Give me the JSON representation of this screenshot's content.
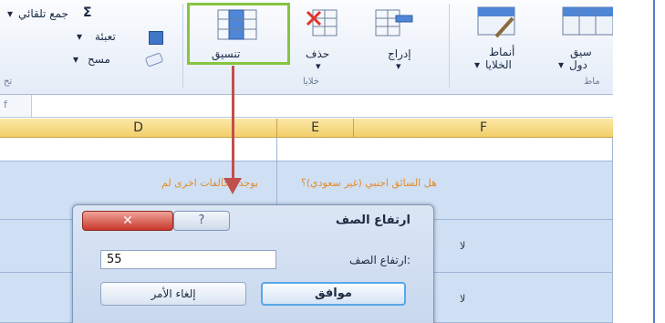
{
  "ribbon": {
    "editing": {
      "autosum_label": "جمع تلقائي",
      "autosum_symbol": "Σ",
      "fill_label": "تعبئة",
      "clear_label": "مسح",
      "group_label": "تح"
    },
    "cells": {
      "format_label": "تنسيق",
      "delete_label": "حذف",
      "insert_label": "إدراج",
      "group_label": "خلايا"
    },
    "styles": {
      "cell_styles_label_1": "أنماط",
      "cell_styles_label_2": "الخلايا",
      "format_table_label_1": "سيق",
      "format_table_label_2": "دول",
      "group_label": "ماط"
    }
  },
  "formula_bar": {
    "fx_symbol": "f"
  },
  "columns": {
    "d": "D",
    "e": "E",
    "f": "F"
  },
  "grid": {
    "header_d": "يوجد مخالفات اخرى لم",
    "header_f": "هل السائق اجنبي (غير سعودي)؟",
    "row1_value": "لا",
    "row2_value": "لا"
  },
  "dialog": {
    "title": "ارتفاع الصف",
    "close_symbol": "✕",
    "help_symbol": "?",
    "row_height_label": "ارتفاع الصف:",
    "row_height_value": "55",
    "ok_label": "موافق",
    "cancel_label": "إلغاء الأمر"
  },
  "colors": {
    "highlight_box": "#86c442",
    "arrow": "#c0504d",
    "header_orange_text": "#e38b2a",
    "cell_fill": "#cfe0f5"
  }
}
